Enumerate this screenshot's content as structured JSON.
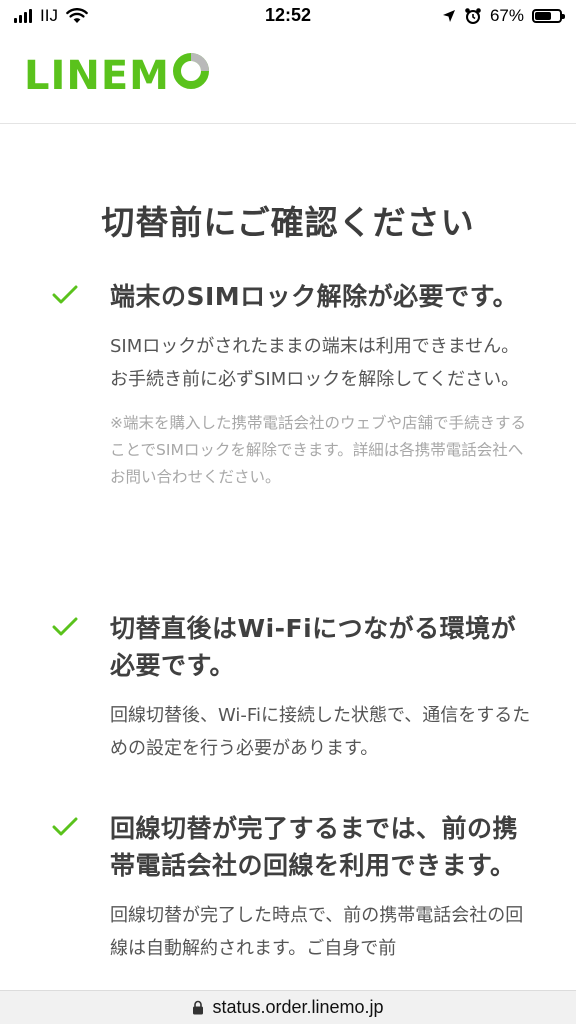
{
  "status_bar": {
    "carrier": "IIJ",
    "time": "12:52",
    "battery_percent_label": "67%",
    "battery_level": 0.67,
    "icons": [
      "signal-icon",
      "wifi-icon",
      "location-arrow-icon",
      "alarm-icon",
      "battery-icon"
    ]
  },
  "header": {
    "logo_text": "LINEM",
    "logo_last": "O",
    "brand_color": "#5ac21c"
  },
  "main": {
    "title": "切替前にご確認ください",
    "items": [
      {
        "heading": "端末のSIMロック解除が必要です。",
        "body": "SIMロックがされたままの端末は利用できません。お手続き前に必ずSIMロックを解除してください。",
        "note": "※端末を購入した携帯電話会社のウェブや店舗で手続きすることでSIMロックを解除できます。詳細は各携帯電話会社へお問い合わせください。"
      },
      {
        "heading": "切替直後はWi-Fiにつながる環境が必要です。",
        "body": "回線切替後、Wi-Fiに接続した状態で、通信をするための設定を行う必要があります。"
      },
      {
        "heading": "回線切替が完了するまでは、前の携帯電話会社の回線を利用できます。",
        "body": "回線切替が完了した時点で、前の携帯電話会社の回線は自動解約されます。ご自身で前"
      }
    ]
  },
  "url_bar": {
    "url": "status.order.linemo.jp"
  }
}
